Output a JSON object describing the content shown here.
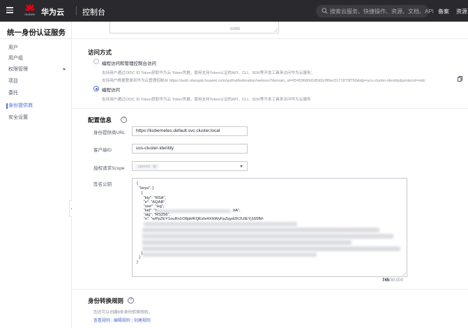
{
  "topbar": {
    "logo_text": "HUAWEI",
    "brand": "华为云",
    "console": "控制台",
    "search_placeholder": "搜索云服务、快捷操作、资源、文档、API",
    "links": [
      "备案",
      "资源"
    ]
  },
  "sidebar": {
    "title": "统一身份认证服务",
    "items": [
      {
        "label": "用户"
      },
      {
        "label": "用户组"
      },
      {
        "label": "权限管理"
      },
      {
        "label": "项目"
      },
      {
        "label": "委托"
      },
      {
        "label": "身份提供商"
      },
      {
        "label": "安全设置"
      }
    ]
  },
  "description_counter": "0/255",
  "access": {
    "title": "访问方式",
    "option1_label": "编程访问和管理控制台访问",
    "option1_desc1": "支持用户通过OIDC ID Token获取华为云 Token凭据，使用支持Token认证的API、CLI、SDK等开发工具来访问华为云服务；",
    "option1_desc2": "支持用户根据登录到华为云管理控制台 https://auth.ulanqab.huawei.com/authui/federation/websso?domain_id=05459680d180d3c9f9ec0171879f760&idp=ucs-cluster-identity&protocol=oidc",
    "option2_label": "编程访问",
    "option2_desc": "支持用户通过OIDC ID Token获取华为云 Token凭据，使用支持Token认证的API、CLI、SDK等开发工具来访问华为云服务"
  },
  "config": {
    "title": "配置信息",
    "provider_url_label": "身份提供商URL",
    "provider_url_value": "https://kubernetes.default.svc.cluster.local",
    "client_id_label": "客户端ID",
    "client_id_value": "ucs-cluster-identity",
    "scope_label": "授权请求Scope",
    "scope_tag": "openid",
    "signing_key_label": "签名公钥",
    "key_lines": [
      "{",
      "  \"keys\": [",
      "    {",
      "      \"kty\": \"RSA\",",
      "      \"e\": \"AQAB\",",
      "      \"use\": \"sig\",",
      "      \"kid\": \"h",
      "      \"alg\": \"RS256\",",
      "      \"n\": \"wPpZEY1ouRn1O8pkfKQExfx4XHWyFpZqydZK2UlEYj165fM-"
    ],
    "kid_tail": "ItA\",",
    "key_end_lines": [
      "    }",
      "  ]",
      "}"
    ],
    "key_counter_current": "745",
    "key_counter_max": "/30,000"
  },
  "mapping": {
    "title": "身份转换规则",
    "desc": "您还可以创建8条身份转换规则。",
    "links": [
      "查看规则",
      "编辑规则",
      "创建规则"
    ],
    "sep": "|"
  },
  "colors": {
    "accent": "#526ecc",
    "topbar_bg": "#2a2a2e",
    "logo_red": "#e60012"
  }
}
